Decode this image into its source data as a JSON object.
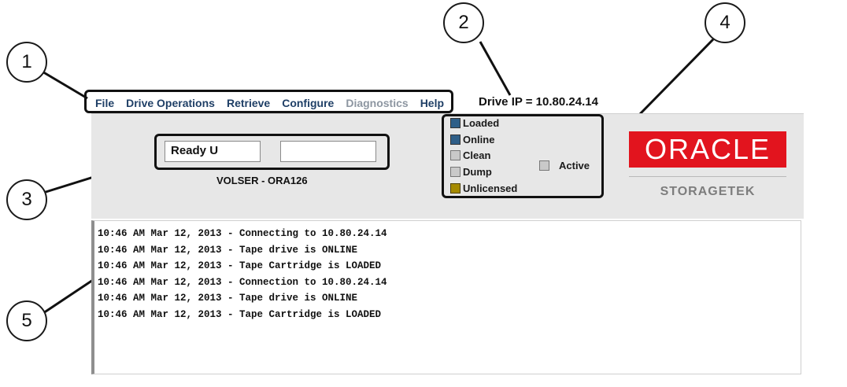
{
  "menu": {
    "items": [
      {
        "label": "File",
        "enabled": true
      },
      {
        "label": "Drive Operations",
        "enabled": true
      },
      {
        "label": "Retrieve",
        "enabled": true
      },
      {
        "label": "Configure",
        "enabled": true
      },
      {
        "label": "Diagnostics",
        "enabled": false
      },
      {
        "label": "Help",
        "enabled": true
      }
    ]
  },
  "drive_ip": "Drive IP = 10.80.24.14",
  "status": {
    "field1": "Ready U",
    "field2": "",
    "volser": "VOLSER - ORA126"
  },
  "indicators": [
    {
      "label": "Loaded",
      "color": "#2f5f88"
    },
    {
      "label": "Online",
      "color": "#2f5f88"
    },
    {
      "label": "Clean",
      "color": "#c9c9c9"
    },
    {
      "label": "Dump",
      "color": "#c9c9c9"
    },
    {
      "label": "Unlicensed",
      "color": "#a58a00"
    }
  ],
  "active": {
    "label": "Active",
    "color": "#c9c9c9"
  },
  "logo": {
    "brand": "ORACLE",
    "sub": "STORAGETEK",
    "brand_color": "#e2141e"
  },
  "log": [
    "10:46 AM Mar 12, 2013 - Connecting to 10.80.24.14",
    "10:46 AM Mar 12, 2013 - Tape drive is ONLINE",
    "10:46 AM Mar 12, 2013 - Tape Cartridge is LOADED",
    "10:46 AM Mar 12, 2013 - Connection to 10.80.24.14",
    "10:46 AM Mar 12, 2013 - Tape drive is ONLINE",
    "10:46 AM Mar 12, 2013 - Tape Cartridge is LOADED"
  ],
  "callouts": [
    "1",
    "2",
    "3",
    "4",
    "5"
  ]
}
